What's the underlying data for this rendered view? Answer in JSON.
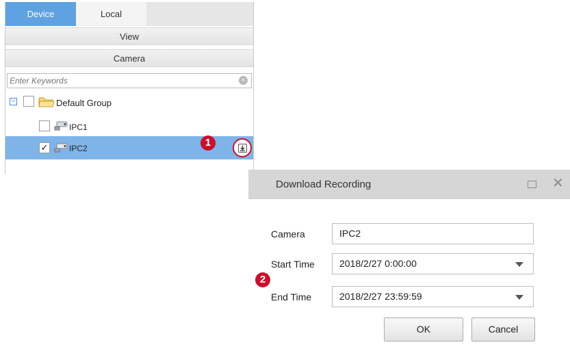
{
  "tabs": {
    "device": "Device",
    "local": "Local"
  },
  "sections": {
    "view": "View",
    "camera": "Camera"
  },
  "search": {
    "placeholder": "Enter Keywords"
  },
  "tree": {
    "group": {
      "label": "Default Group",
      "expander": "−"
    },
    "items": [
      {
        "label": "IPC1",
        "checked": false,
        "selected": false
      },
      {
        "label": "IPC2",
        "checked": true,
        "selected": true,
        "check_mark": "✓"
      }
    ]
  },
  "callouts": {
    "step1": "1",
    "step2": "2"
  },
  "dialog": {
    "title": "Download Recording",
    "close": "✕",
    "fields": {
      "camera_label": "Camera",
      "camera_value": "IPC2",
      "start_label": "Start Time",
      "start_value": "2018/2/27 0:00:00",
      "end_label": "End Time",
      "end_value": "2018/2/27 23:59:59"
    },
    "buttons": {
      "ok": "OK",
      "cancel": "Cancel"
    }
  },
  "colors": {
    "tab_active": "#5ea2e2",
    "row_selected": "#7eb4e8",
    "callout": "#c8102e",
    "dialog_header": "#d6d6d6"
  },
  "icons": [
    "folder-icon",
    "camera-icon",
    "download-icon",
    "clear-search-icon",
    "maximize-icon",
    "close-icon",
    "dropdown-arrow-icon"
  ]
}
